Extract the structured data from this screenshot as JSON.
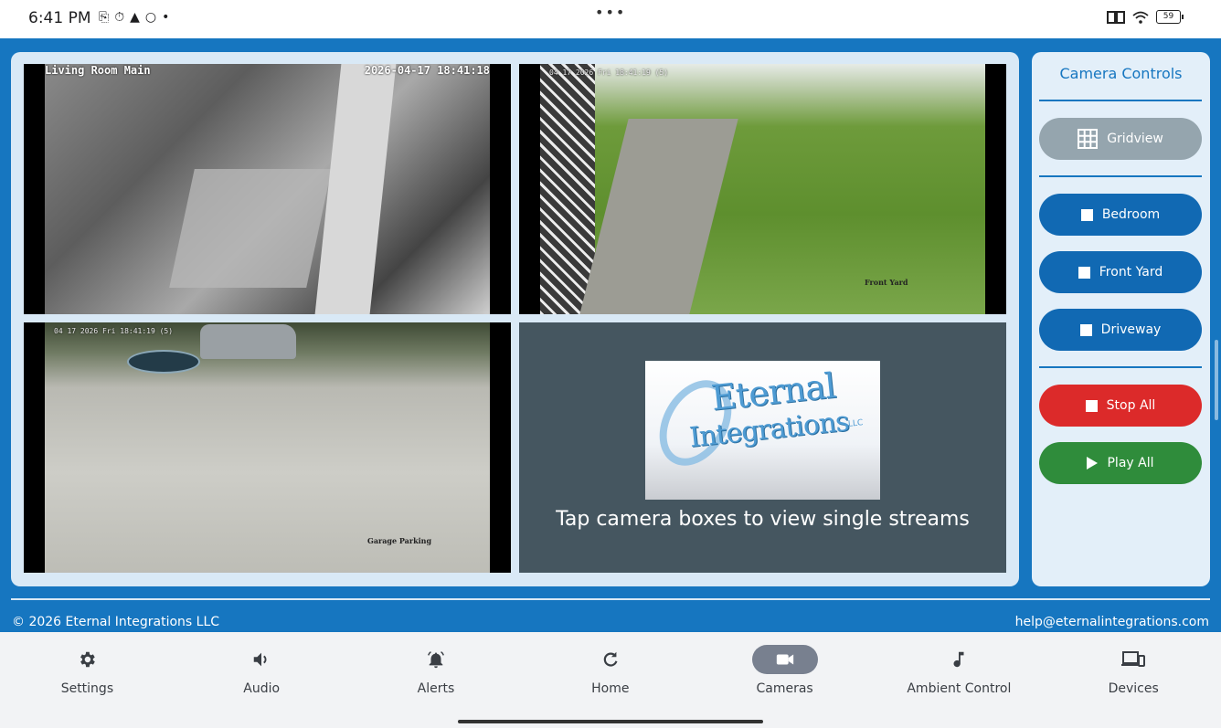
{
  "status_bar": {
    "time": "6:41 PM",
    "left_icons": [
      "cast-icon",
      "timer-icon",
      "keyhole-icon",
      "sync-icon",
      "dot-icon"
    ],
    "more": "•••",
    "battery": "59"
  },
  "cameras": {
    "living_room": {
      "label": "Living Room Main",
      "timestamp": "2026-04-17 18:41:18"
    },
    "front_yard": {
      "timestamp": "04 17 2026 Fri 18:41:19 (5)",
      "label": "Front Yard"
    },
    "garage": {
      "timestamp": "04 17 2026 Fri 18:41:19 (5)",
      "label": "Garage Parking"
    },
    "info_tile": {
      "logo_line1": "Eternal",
      "logo_line2": "Integrations",
      "logo_llc": "LLC",
      "hint": "Tap camera boxes to view single streams"
    }
  },
  "controls": {
    "title": "Camera Controls",
    "gridview": "Gridview",
    "bedroom": "Bedroom",
    "front_yard": "Front Yard",
    "driveway": "Driveway",
    "stop_all": "Stop All",
    "play_all": "Play All"
  },
  "footer": {
    "copyright": "© 2026 Eternal Integrations LLC",
    "email": "help@eternalintegrations.com"
  },
  "nav": {
    "items": [
      {
        "label": "Settings",
        "icon": "gear-icon"
      },
      {
        "label": "Audio",
        "icon": "speaker-icon"
      },
      {
        "label": "Alerts",
        "icon": "bell-icon"
      },
      {
        "label": "Home",
        "icon": "refresh-icon"
      },
      {
        "label": "Cameras",
        "icon": "video-camera-icon",
        "active": true
      },
      {
        "label": "Ambient Control",
        "icon": "music-note-icon"
      },
      {
        "label": "Devices",
        "icon": "devices-icon"
      }
    ]
  },
  "colors": {
    "app_blue": "#1676c0",
    "panel_bg": "#d9e9f6",
    "stop_red": "#dc2a2a",
    "play_green": "#2f8c3b",
    "grid_gray": "#95a5ae"
  }
}
